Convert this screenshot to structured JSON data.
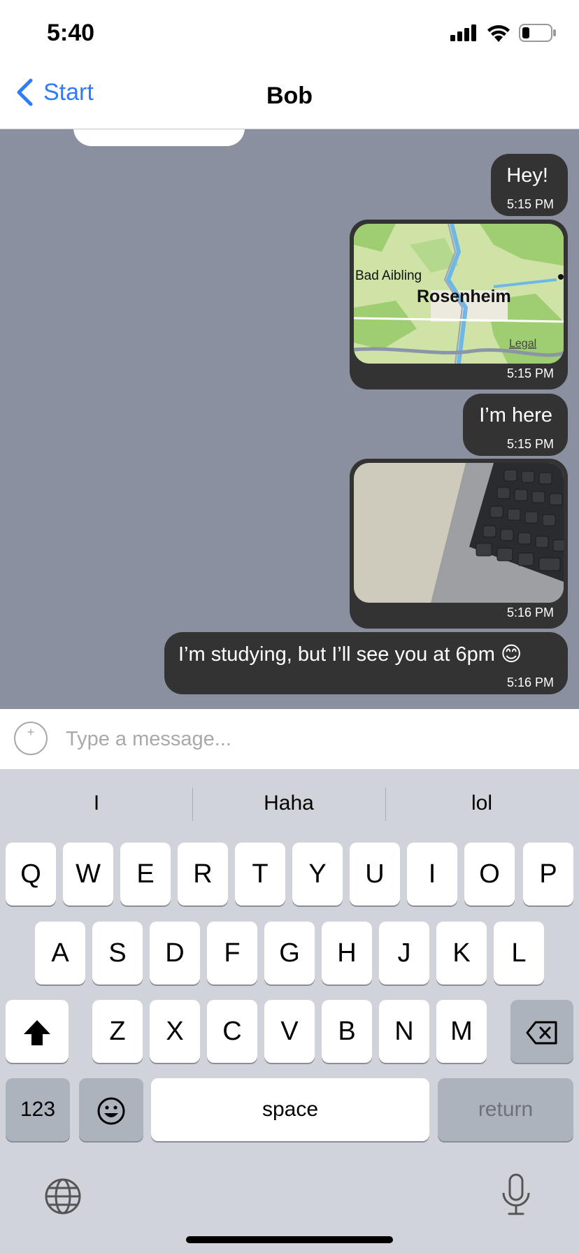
{
  "status": {
    "time": "5:40",
    "icons": [
      "cellular-signal-icon",
      "wifi-icon",
      "battery-icon"
    ]
  },
  "nav": {
    "back_label": "Start",
    "title": "Bob"
  },
  "messages": [
    {
      "type": "text",
      "text": "Hey!",
      "time": "5:15 PM"
    },
    {
      "type": "map",
      "labels": [
        "Bad Aibling",
        "Rosenheim",
        "Legal"
      ],
      "time": "5:15 PM"
    },
    {
      "type": "text",
      "text": "I’m here",
      "time": "5:15 PM"
    },
    {
      "type": "photo",
      "time": "5:16 PM"
    },
    {
      "type": "text",
      "text": "I’m studying, but I’ll see you at 6pm 😊",
      "time": "5:16 PM"
    }
  ],
  "input": {
    "placeholder": "Type a message..."
  },
  "keyboard": {
    "suggestions": [
      "I",
      "Haha",
      "lol"
    ],
    "row1": [
      "Q",
      "W",
      "E",
      "R",
      "T",
      "Y",
      "U",
      "I",
      "O",
      "P"
    ],
    "row2": [
      "A",
      "S",
      "D",
      "F",
      "G",
      "H",
      "J",
      "K",
      "L"
    ],
    "row3": [
      "Z",
      "X",
      "C",
      "V",
      "B",
      "N",
      "M"
    ],
    "numbers_label": "123",
    "space_label": "space",
    "return_label": "return"
  },
  "colors": {
    "accent": "#2f7cf6",
    "chat_background": "#8a909f",
    "bubble": "#333333",
    "keyboard": "#d0d3da"
  }
}
